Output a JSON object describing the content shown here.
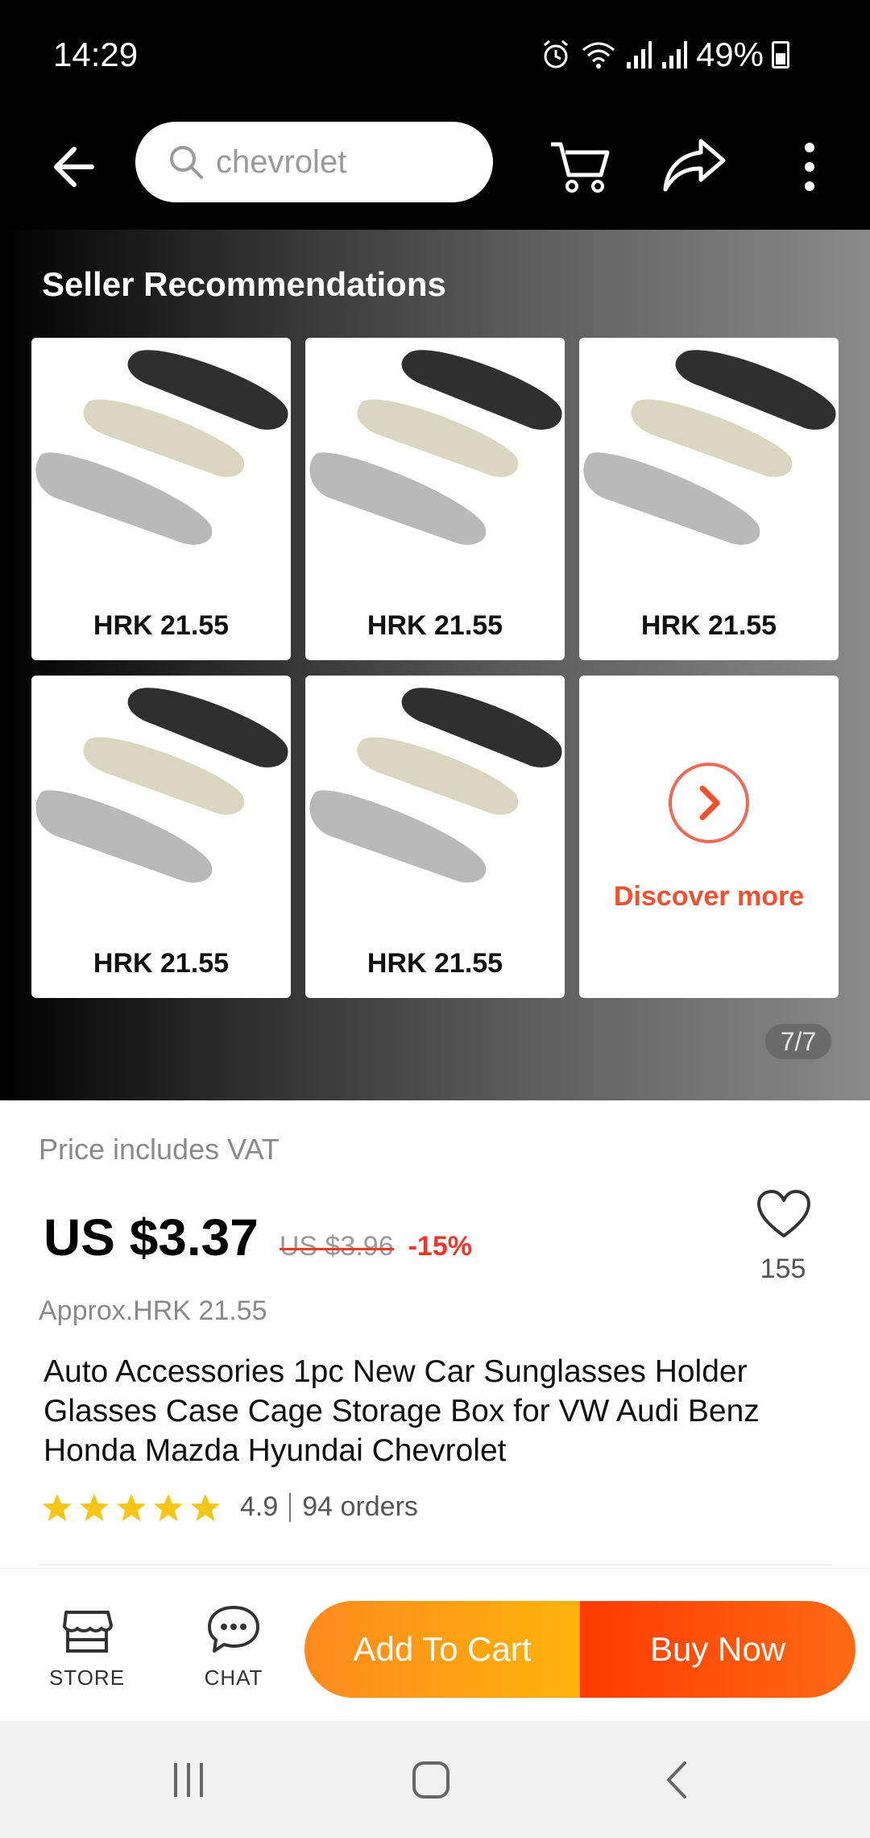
{
  "status_bar": {
    "time": "14:29",
    "battery": "49%"
  },
  "search": {
    "placeholder": "chevrolet"
  },
  "seller_recommendations": {
    "title": "Seller Recommendations",
    "items": [
      {
        "price": "HRK 21.55"
      },
      {
        "price": "HRK 21.55"
      },
      {
        "price": "HRK 21.55"
      },
      {
        "price": "HRK 21.55"
      },
      {
        "price": "HRK 21.55"
      }
    ],
    "discover_more": "Discover more",
    "pager": "7/7"
  },
  "product": {
    "vat_note": "Price includes VAT",
    "price": "US $3.37",
    "old_price": "US $3.96",
    "discount": "-15%",
    "wishlist_count": "155",
    "approx": "Approx.HRK 21.55",
    "title": "Auto Accessories 1pc New Car Sunglasses Holder Glasses Case Cage Storage Box for VW Audi Benz Honda Mazda Hyundai Chevrolet",
    "rating": "4.9",
    "stars": 5,
    "orders": "94 orders"
  },
  "bottom_bar": {
    "store_label": "STORE",
    "chat_label": "CHAT",
    "add_to_cart": "Add To Cart",
    "buy_now": "Buy Now"
  },
  "colors": {
    "accent": "#f2502e",
    "cart": "#ffa010",
    "buy": "#ff4a08",
    "star": "#f5c518"
  }
}
